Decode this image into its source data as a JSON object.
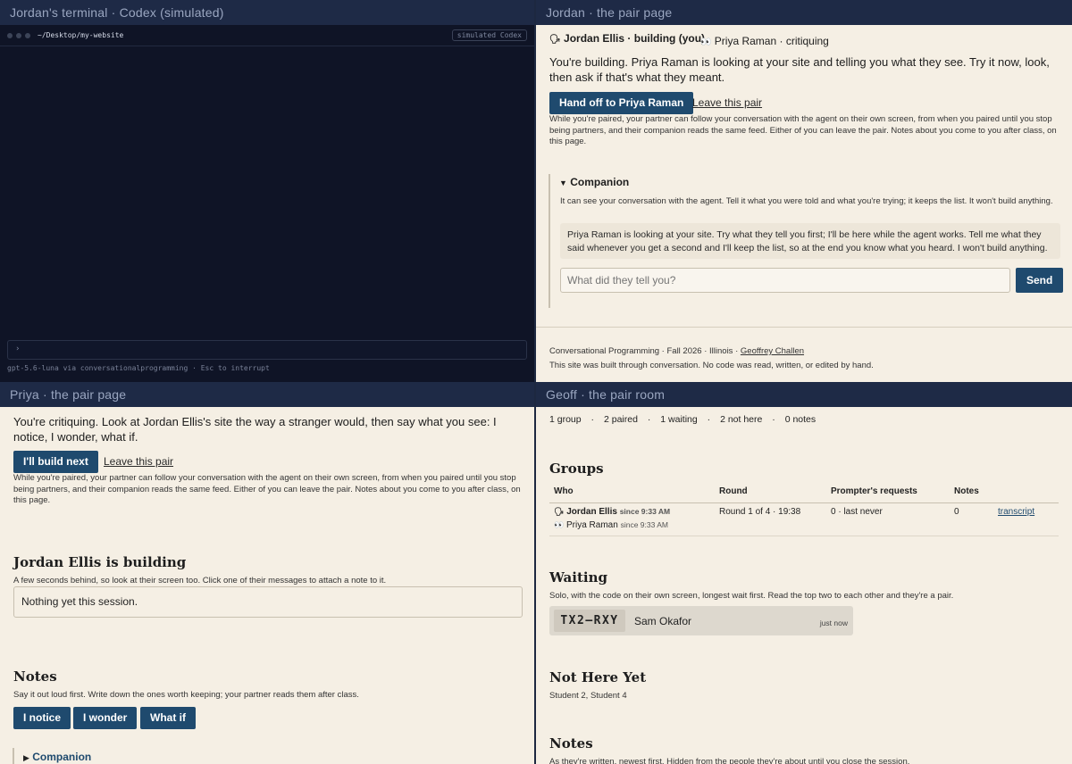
{
  "terminal": {
    "title": "Jordan's terminal · Codex (simulated)",
    "path": "~/Desktop/my-website",
    "badge": "simulated Codex",
    "prompt": "›",
    "status": "gpt-5.6-luna via conversationalprogramming  ·  Esc to interrupt"
  },
  "jordan": {
    "title": "Jordan · the pair page",
    "self_icon": "🗣",
    "self_label": "Jordan Ellis · building (you)",
    "partner_icon": "👀",
    "partner_label": "Priya Raman · critiquing",
    "intro": "You're building. Priya Raman is looking at your site and telling you what they see. Try it now, look, then ask if that's what they meant.",
    "handoff_button": "Hand off to Priya Raman",
    "leave_link": "Leave this pair",
    "pair_note": "While you're paired, your partner can follow your conversation with the agent on their own screen, from when you paired until you stop being partners, and their companion reads the same feed. Either of you can leave the pair. Notes about you come to you after class, on this page.",
    "companion_title": "Companion",
    "companion_desc": "It can see your conversation with the agent. Tell it what you were told and what you're trying; it keeps the list. It won't build anything.",
    "companion_message": "Priya Raman is looking at your site. Try what they tell you first; I'll be here while the agent works. Tell me what they said whenever you get a second and I'll keep the list, so at the end you know what you heard. I won't build anything.",
    "input_placeholder": "What did they tell you?",
    "send_button": "Send",
    "footer_course": "Conversational Programming",
    "footer_term": "Fall 2026",
    "footer_school": "Illinois",
    "footer_author": "Geoffrey Challen",
    "footer_note": "This site was built through conversation. No code was read, written, or edited by hand."
  },
  "priya": {
    "title": "Priya · the pair page",
    "intro": "You're critiquing. Look at Jordan Ellis's site the way a stranger would, then say what you see: I notice, I wonder, what if.",
    "build_button": "I'll build next",
    "leave_link": "Leave this pair",
    "pair_note": "While you're paired, your partner can follow your conversation with the agent on their own screen, from when you paired until you stop being partners, and their companion reads the same feed. Either of you can leave the pair. Notes about you come to you after class, on this page.",
    "building_heading": "Jordan Ellis is building",
    "building_desc": "A few seconds behind, so look at their screen too. Click one of their messages to attach a note to it.",
    "feed_empty": "Nothing yet this session.",
    "notes_heading": "Notes",
    "notes_desc": "Say it out loud first. Write down the ones worth keeping; your partner reads them after class.",
    "note_buttons": [
      "I notice",
      "I wonder",
      "What if"
    ],
    "companion_title": "Companion"
  },
  "geoff": {
    "title": "Geoff · the pair room",
    "stats": [
      "1 group",
      "2 paired",
      "1 waiting",
      "2 not here",
      "0 notes"
    ],
    "groups_heading": "Groups",
    "columns": [
      "Who",
      "Round",
      "Prompter's requests",
      "Notes"
    ],
    "group_row": {
      "member1_icon": "🗣",
      "member1_name": "Jordan Ellis",
      "member1_since": "since 9:33 AM",
      "member2_icon": "👀",
      "member2_name": "Priya Raman",
      "member2_since": "since 9:33 AM",
      "round": "Round 1 of 4 · 19:38",
      "requests": "0 · last never",
      "notes": "0",
      "transcript_link": "transcript"
    },
    "waiting_heading": "Waiting",
    "waiting_desc": "Solo, with the code on their own screen, longest wait first. Read the top two to each other and they're a pair.",
    "waiting_code": "TX2–RXY",
    "waiting_name": "Sam Okafor",
    "waiting_time": "just now",
    "not_here_heading": "Not Here Yet",
    "not_here_list": "Student 2, Student 4",
    "notes_heading": "Notes",
    "notes_desc": "As they're written, newest first. Hidden from the people they're about until you close the session."
  }
}
